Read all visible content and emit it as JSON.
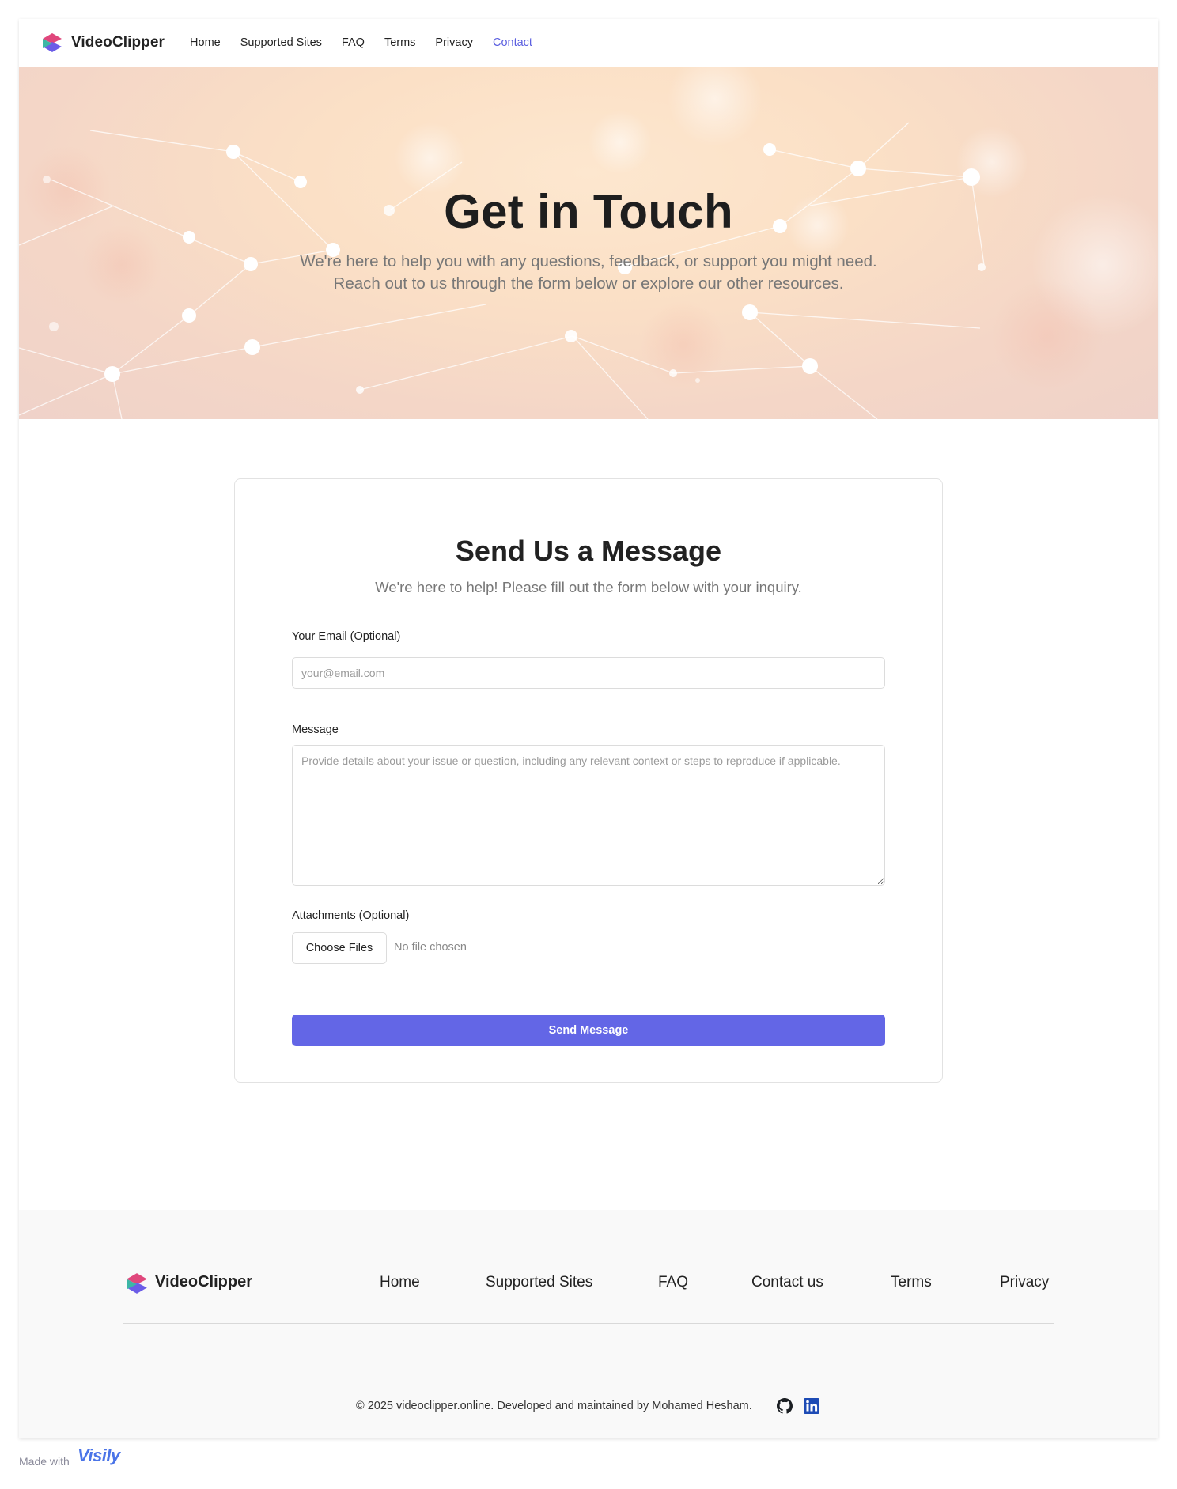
{
  "nav": {
    "brand": "VideoClipper",
    "links": [
      {
        "label": "Home",
        "active": false
      },
      {
        "label": "Supported Sites",
        "active": false
      },
      {
        "label": "FAQ",
        "active": false
      },
      {
        "label": "Terms",
        "active": false
      },
      {
        "label": "Privacy",
        "active": false
      },
      {
        "label": "Contact",
        "active": true
      }
    ],
    "active_color": "#5b5fe0"
  },
  "hero": {
    "title": "Get in Touch",
    "subtitle_line1": "We're here to help you with any questions, feedback, or support you might need.",
    "subtitle_line2": "Reach out to us through the form below or explore our other resources."
  },
  "form": {
    "title": "Send Us a Message",
    "subtitle": "We're here to help! Please fill out the form below with your inquiry.",
    "email_label": "Your Email (Optional)",
    "email_placeholder": "your@email.com",
    "email_value": "",
    "message_label": "Message",
    "message_placeholder": "Provide details about your issue or question, including any relevant context or steps to reproduce if applicable.",
    "attachments_label": "Attachments (Optional)",
    "choose_files_label": "Choose Files",
    "file_status": "No file chosen",
    "send_label": "Send Message",
    "send_color": "#6366e6"
  },
  "footer": {
    "brand": "VideoClipper",
    "links": [
      "Home",
      "Supported Sites",
      "FAQ",
      "Contact us",
      "Terms",
      "Privacy"
    ],
    "copyright": "© 2025 videoclipper.online. Developed and maintained by Mohamed Hesham.",
    "social_icons": [
      "github-icon",
      "linkedin-icon"
    ]
  },
  "badge": {
    "made_with": "Made with",
    "tool": "Visily"
  }
}
